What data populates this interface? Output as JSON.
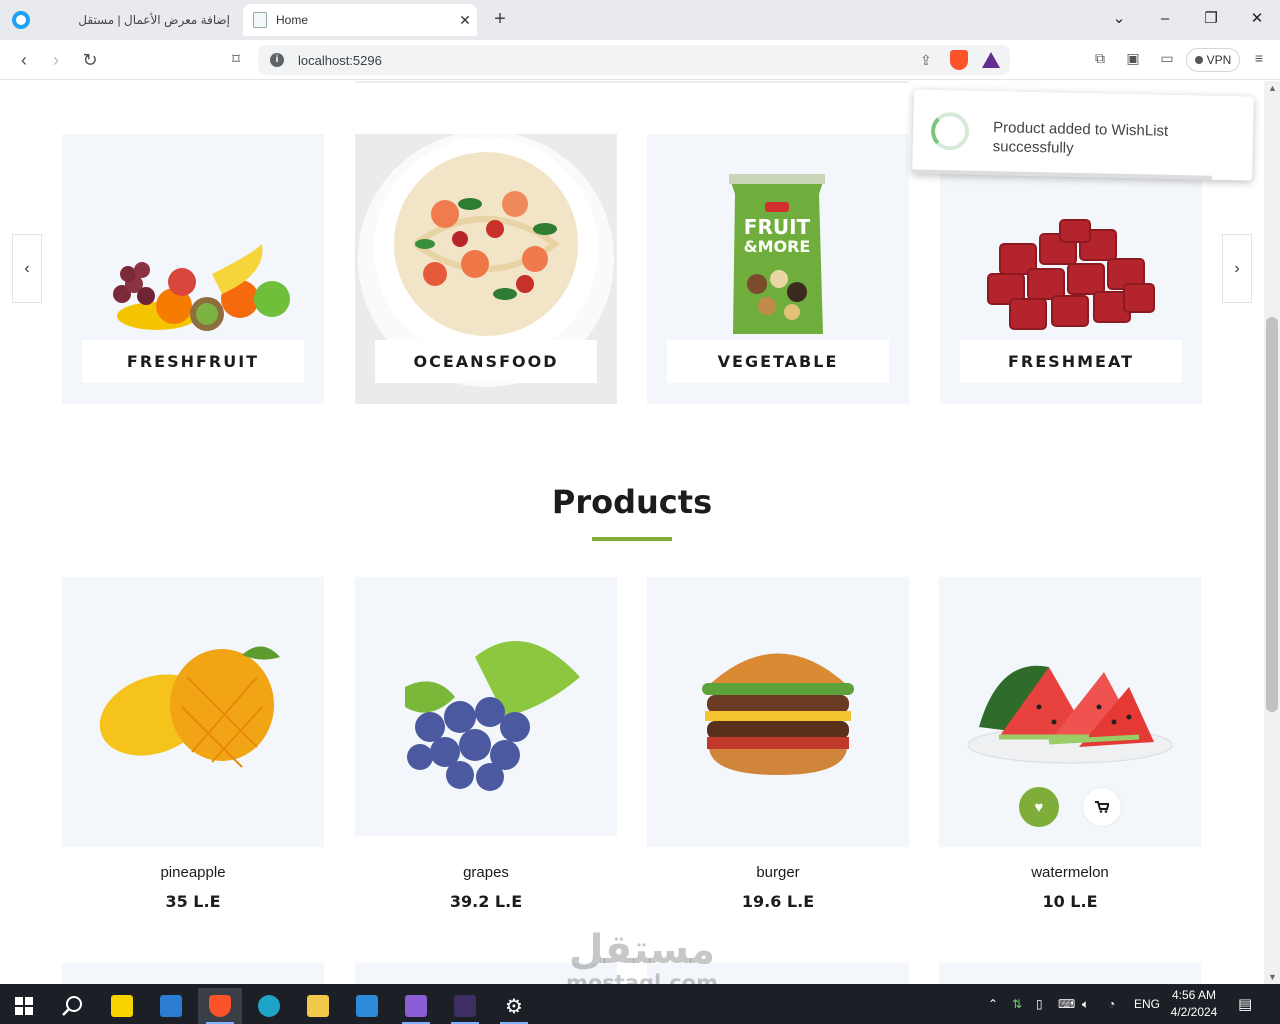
{
  "browser": {
    "tabs": [
      {
        "title": "إضافة معرض الأعمال | مستقل",
        "active": false
      },
      {
        "title": "Home",
        "active": true
      }
    ],
    "url": "localhost:5296",
    "vpn_label": "VPN",
    "new_tab_icon": "plus-icon",
    "close_icon": "close-icon"
  },
  "categories": [
    {
      "label": "FRESHFRUIT",
      "image": "mixed-fruit-image"
    },
    {
      "label": "OCEANSFOOD",
      "image": "seafood-pasta-image"
    },
    {
      "label": "VEGETABLE",
      "image": "fruit-and-more-bag-image"
    },
    {
      "label": "FRESHMEAT",
      "image": "meat-cubes-image"
    }
  ],
  "carousel": {
    "prev_icon": "chevron-left-icon",
    "next_icon": "chevron-right-icon"
  },
  "products_section": {
    "title": "Products",
    "items": [
      {
        "name": "pineapple",
        "price": "35 L.E",
        "image": "mango-image"
      },
      {
        "name": "grapes",
        "price": "39.2 L.E",
        "image": "grapes-image"
      },
      {
        "name": "burger",
        "price": "19.6 L.E",
        "image": "burger-image"
      },
      {
        "name": "watermelon",
        "price": "10 L.E",
        "image": "watermelon-image",
        "wishlisted": true
      }
    ],
    "hover_actions": {
      "wishlist_icon": "heart-icon",
      "cart_icon": "cart-icon"
    }
  },
  "toast": {
    "message": "Product added to WishList successfully"
  },
  "watermark": {
    "arabic": "مستقل",
    "latin": "mostaql.com"
  },
  "taskbar": {
    "language": "ENG",
    "time": "4:56 AM",
    "date": "4/2/2024"
  },
  "colors": {
    "accent": "#7fad39",
    "card_bg": "#f3f6fa",
    "taskbar": "#1c1f26"
  }
}
